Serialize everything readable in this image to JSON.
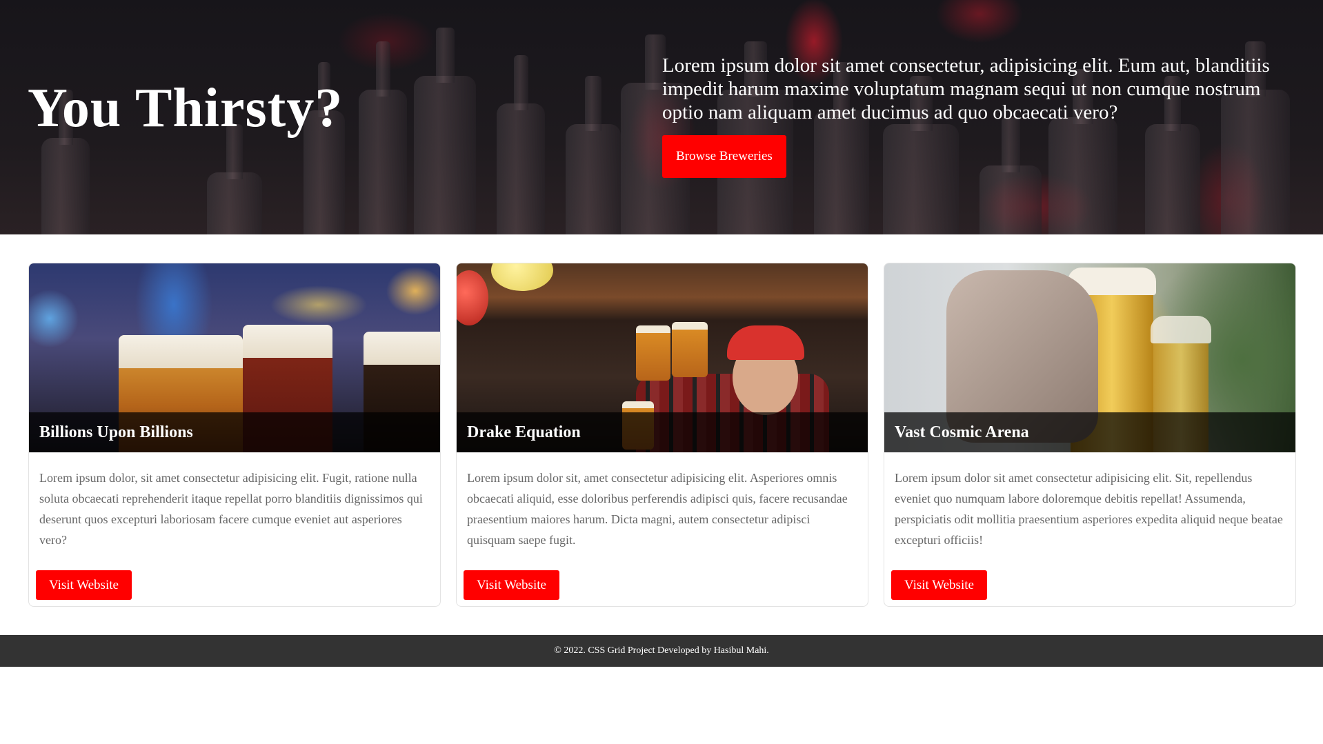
{
  "hero": {
    "title": "You Thirsty?",
    "text": "Lorem ipsum dolor sit amet consectetur, adipisicing elit. Eum aut, blanditiis impedit harum maxime voluptatum magnam sequi ut non cumque nostrum optio nam aliquam amet ducimus ad quo obcaecati vero?",
    "button_label": "Browse Breweries"
  },
  "cards": [
    {
      "title": "Billions Upon Billions",
      "text": "Lorem ipsum dolor, sit amet consectetur adipisicing elit. Fugit, ratione nulla soluta obcaecati reprehenderit itaque repellat porro blanditiis dignissimos qui deserunt quos excepturi laboriosam facere cumque eveniet aut asperiores vero?",
      "button_label": "Visit Website"
    },
    {
      "title": "Drake Equation",
      "text": "Lorem ipsum dolor sit, amet consectetur adipisicing elit. Asperiores omnis obcaecati aliquid, esse doloribus perferendis adipisci quis, facere recusandae praesentium maiores harum. Dicta magni, autem consectetur adipisci quisquam saepe fugit.",
      "button_label": "Visit Website"
    },
    {
      "title": "Vast Cosmic Arena",
      "text": "Lorem ipsum dolor sit amet consectetur adipisicing elit. Sit, repellendus eveniet quo numquam labore doloremque debitis repellat! Assumenda, perspiciatis odit mollitia praesentium asperiores expedita aliquid neque beatae excepturi officiis!",
      "button_label": "Visit Website"
    }
  ],
  "footer": {
    "text": "© 2022. CSS Grid Project Developed by Hasibul Mahi."
  },
  "colors": {
    "accent": "#ff0000",
    "footer_bg": "#333333",
    "caption_bg": "#000000"
  }
}
